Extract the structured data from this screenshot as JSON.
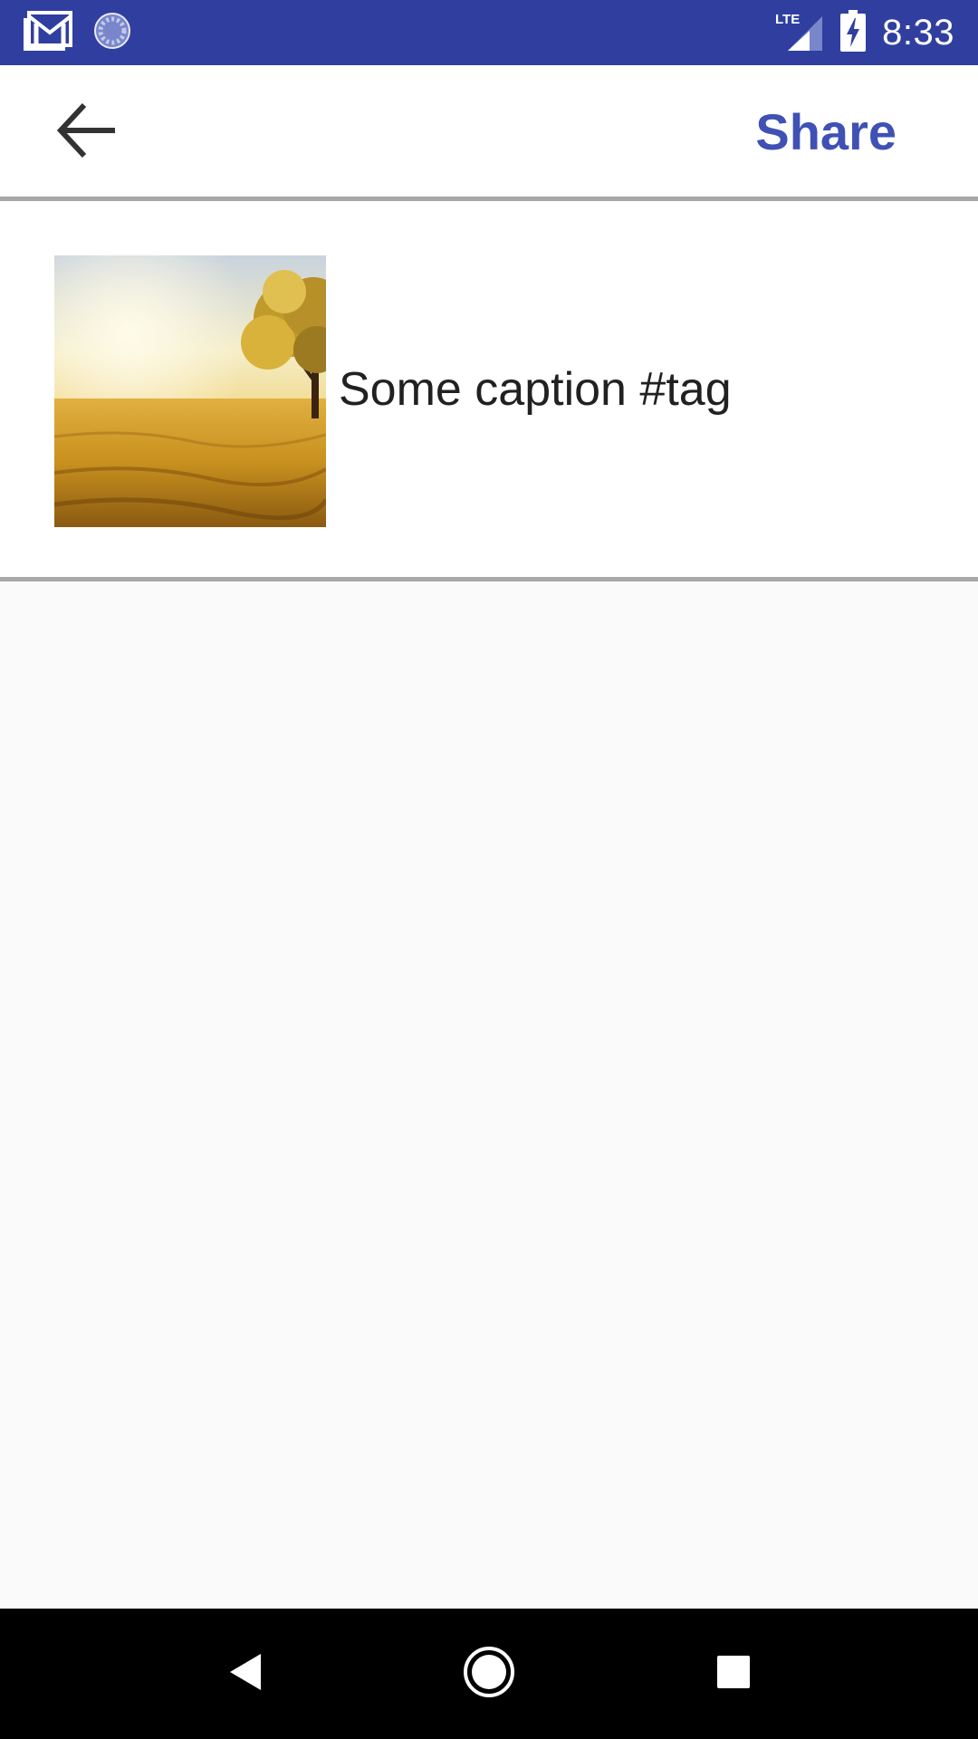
{
  "status_bar": {
    "time": "8:33",
    "network": "LTE",
    "color": "#303f9f",
    "icons": [
      "gmail-icon",
      "sync-icon",
      "lte-signal-icon",
      "battery-charging-icon"
    ]
  },
  "app_bar": {
    "back_icon": "arrow-back-icon",
    "share_label": "Share",
    "accent_color": "#3f51b5"
  },
  "post": {
    "thumbnail": "golden-field-tree-image",
    "caption": "Some caption #tag"
  },
  "nav_bar": {
    "icons": [
      "back-triangle-icon",
      "home-circle-icon",
      "recents-square-icon"
    ]
  }
}
